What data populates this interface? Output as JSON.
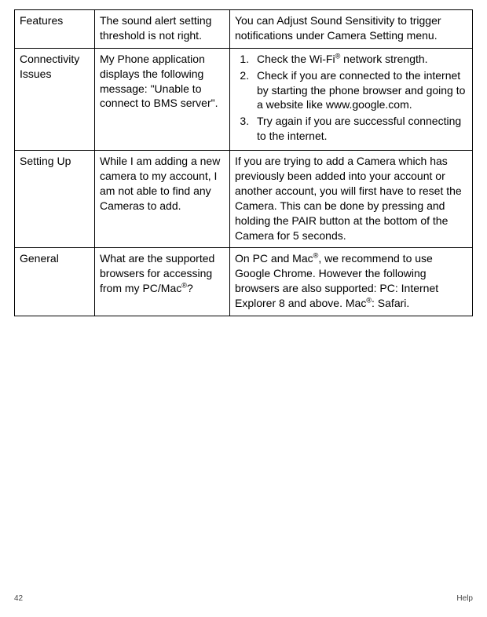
{
  "rows": [
    {
      "category": "Features",
      "problem": "The sound alert setting threshold is not right.",
      "solution_type": "text",
      "solution_text": "You can Adjust Sound Sensitivity to trigger notifications under Camera Setting menu."
    },
    {
      "category": "Connectivity Issues",
      "problem": "My Phone application displays the following message: \"Unable to connect to BMS server\".",
      "solution_type": "list",
      "solution_list": [
        "Check the Wi-Fi{reg} network strength.",
        "Check if you are connected to the internet by starting the phone browser and going to a website like www.google.com.",
        "Try again if you are successful connecting to the internet."
      ]
    },
    {
      "category": "Setting Up",
      "problem": "While I am adding a new camera to my account, I am not able to find any Cameras to add.",
      "solution_type": "text",
      "solution_text": "If you are trying to add a Camera which has previously been added into your account or another account, you will first have to reset the Camera. This can be done by pressing and holding the PAIR button at the bottom of the Camera for 5 seconds."
    },
    {
      "category": "General",
      "problem": "What are the supported browsers for accessing from my PC/Mac{reg}?",
      "solution_type": "text",
      "solution_text": "On PC and Mac{reg}, we recommend to use Google Chrome. However the following browsers are also supported: PC: Internet Explorer 8 and above. Mac{reg}: Safari."
    }
  ],
  "footer": {
    "page_number": "42",
    "section": "Help"
  }
}
